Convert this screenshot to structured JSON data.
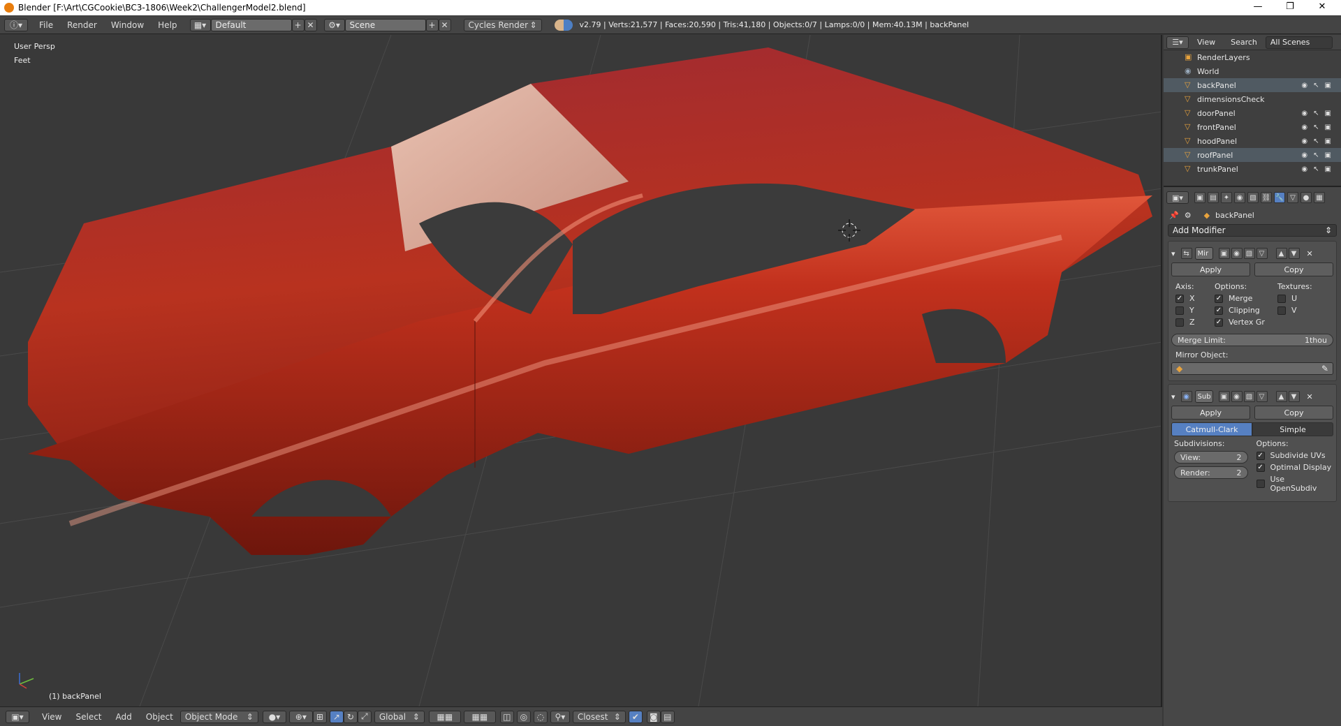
{
  "window": {
    "title": "Blender [F:\\Art\\CGCookie\\BC3-1806\\Week2\\ChallengerModel2.blend]",
    "minimize": "—",
    "restore": "❐",
    "close": "✕"
  },
  "menubar": {
    "items": [
      "File",
      "Render",
      "Window",
      "Help"
    ],
    "layout": "Default",
    "scene": "Scene",
    "engine": "Cycles Render",
    "stats": "v2.79 | Verts:21,577 | Faces:20,590 | Tris:41,180 | Objects:0/7 | Lamps:0/0 | Mem:40.13M | backPanel"
  },
  "viewport": {
    "view_name": "User Persp",
    "units": "Feet",
    "object_label": "(1) backPanel"
  },
  "bottombar": {
    "items": [
      "View",
      "Select",
      "Add",
      "Object"
    ],
    "mode": "Object Mode",
    "orientation": "Global",
    "snap_target": "Closest"
  },
  "outliner": {
    "tabs": [
      "View",
      "Search",
      "All Scenes"
    ],
    "rows": [
      {
        "label": "RenderLayers",
        "icon": "renderlayers-icon"
      },
      {
        "label": "World",
        "icon": "world-icon"
      },
      {
        "label": "backPanel",
        "icon": "mesh-icon"
      },
      {
        "label": "dimensionsCheck",
        "icon": "mesh-icon"
      },
      {
        "label": "doorPanel",
        "icon": "mesh-icon"
      },
      {
        "label": "frontPanel",
        "icon": "mesh-icon"
      },
      {
        "label": "hoodPanel",
        "icon": "mesh-icon"
      },
      {
        "label": "roofPanel",
        "icon": "mesh-icon"
      },
      {
        "label": "trunkPanel",
        "icon": "mesh-icon"
      }
    ]
  },
  "properties": {
    "object_name": "backPanel",
    "add_modifier": "Add Modifier",
    "mirror": {
      "name": "Mir",
      "apply": "Apply",
      "copy": "Copy",
      "axis_label": "Axis:",
      "options_label": "Options:",
      "textures_label": "Textures:",
      "axes": [
        {
          "label": "X",
          "checked": true
        },
        {
          "label": "Y",
          "checked": false
        },
        {
          "label": "Z",
          "checked": false
        }
      ],
      "options": [
        {
          "label": "Merge",
          "checked": true
        },
        {
          "label": "Clipping",
          "checked": true
        },
        {
          "label": "Vertex Gr",
          "checked": true
        }
      ],
      "textures": [
        {
          "label": "U",
          "checked": false
        },
        {
          "label": "V",
          "checked": false
        }
      ],
      "merge_limit_label": "Merge Limit:",
      "merge_limit_value": "1thou",
      "mirror_object_label": "Mirror Object:"
    },
    "subsurf": {
      "name": "Sub",
      "apply": "Apply",
      "copy": "Copy",
      "type_catmull": "Catmull-Clark",
      "type_simple": "Simple",
      "subdivisions_label": "Subdivisions:",
      "options_label": "Options:",
      "view_label": "View:",
      "view_value": "2",
      "render_label": "Render:",
      "render_value": "2",
      "options": [
        {
          "label": "Subdivide UVs",
          "checked": true
        },
        {
          "label": "Optimal Display",
          "checked": true
        },
        {
          "label": "Use OpenSubdiv",
          "checked": false
        }
      ]
    }
  },
  "colors": {
    "accent": "#5680c2",
    "car": "#b5281c",
    "viewport_bg": "#393939"
  }
}
